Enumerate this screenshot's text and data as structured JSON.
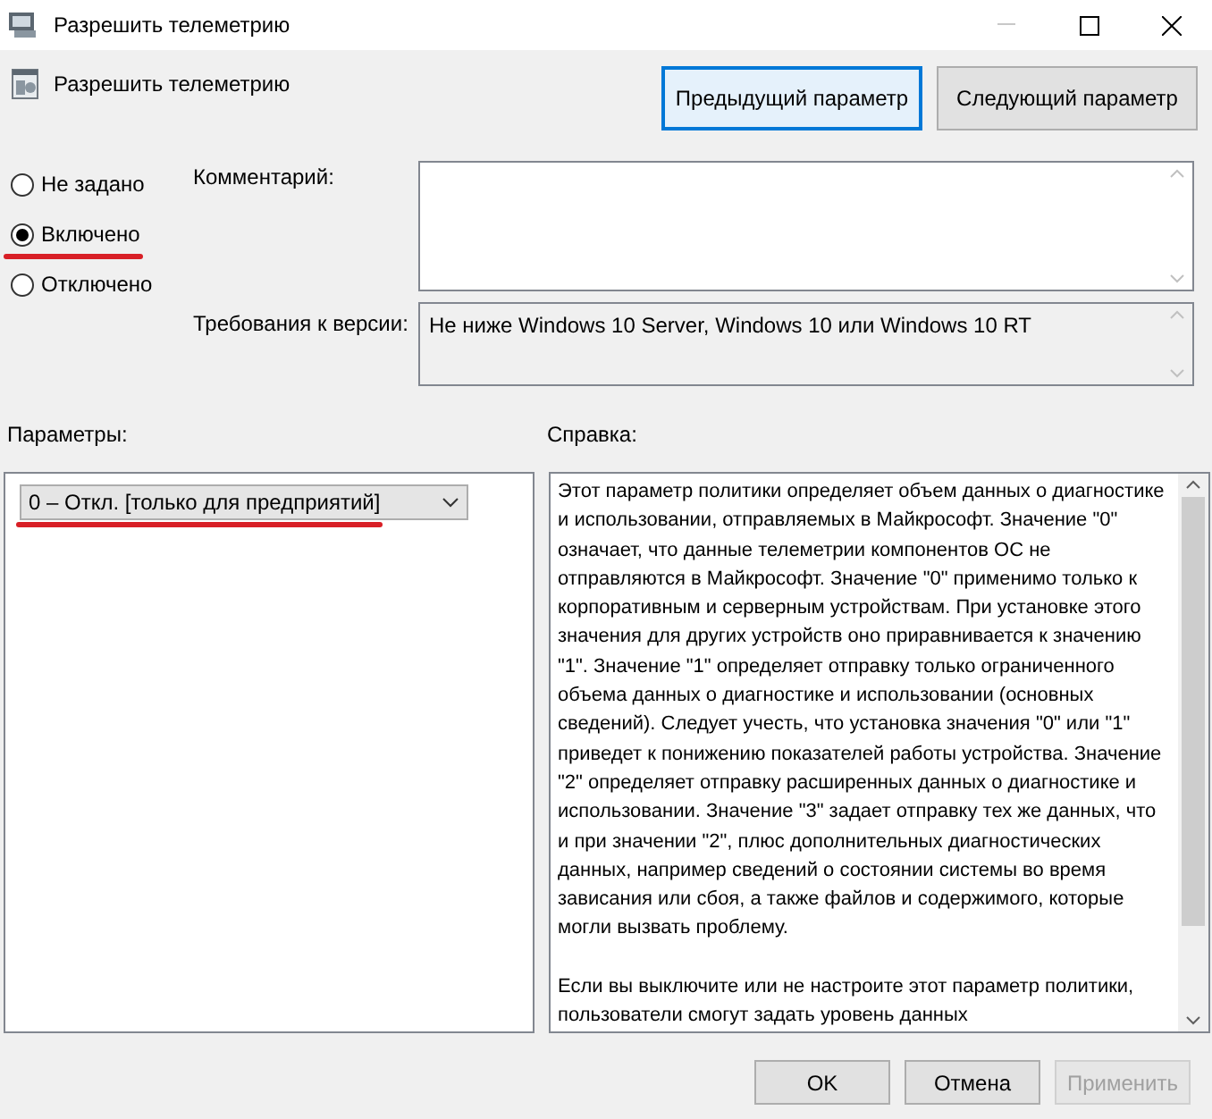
{
  "window": {
    "title": "Разрешить телеметрию"
  },
  "header": {
    "policy_name": "Разрешить телеметрию",
    "buttons": [
      {
        "label": "Предыдущий параметр",
        "focused": true
      },
      {
        "label": "Следующий параметр",
        "focused": false
      }
    ]
  },
  "state_options": [
    {
      "label": "Не задано",
      "selected": false,
      "annotated": false
    },
    {
      "label": "Включено",
      "selected": true,
      "annotated": true
    },
    {
      "label": "Отключено",
      "selected": false,
      "annotated": false
    }
  ],
  "comment": {
    "label": "Комментарий:"
  },
  "requirements": {
    "label": "Требования к версии:",
    "value": "Не ниже Windows 10 Server, Windows 10 или Windows 10 RT"
  },
  "parameters": {
    "label": "Параметры:",
    "dropdown": {
      "value": "0 – Откл. [только для предприятий]",
      "annotated": true
    }
  },
  "help": {
    "label": "Справка:",
    "paragraphs": [
      "Этот параметр политики определяет объем данных о диагностике и использовании, отправляемых в Майкрософт. Значение \"0\" означает, что данные телеметрии компонентов ОС не отправляются в Майкрософт. Значение \"0\" применимо только к корпоративным и серверным устройствам. При установке этого значения для других устройств оно приравнивается к значению \"1\". Значение \"1\" определяет отправку только ограниченного объема данных о диагностике и использовании (основных сведений). Следует учесть, что установка значения \"0\" или \"1\" приведет к понижению показателей работы устройства. Значение \"2\" определяет отправку расширенных данных о диагностике и использовании. Значение \"3\" задает отправку тех же данных, что и при значении \"2\", плюс дополнительных диагностических данных, например сведений о состоянии системы во время зависания или сбоя, а также файлов и содержимого, которые могли вызвать проблему.",
      "Если вы выключите или не настроите этот параметр политики, пользователи смогут задать уровень данных"
    ]
  },
  "footer_buttons": [
    {
      "label": "OK",
      "disabled": false
    },
    {
      "label": "Отмена",
      "disabled": false
    },
    {
      "label": "Применить",
      "disabled": true
    }
  ]
}
